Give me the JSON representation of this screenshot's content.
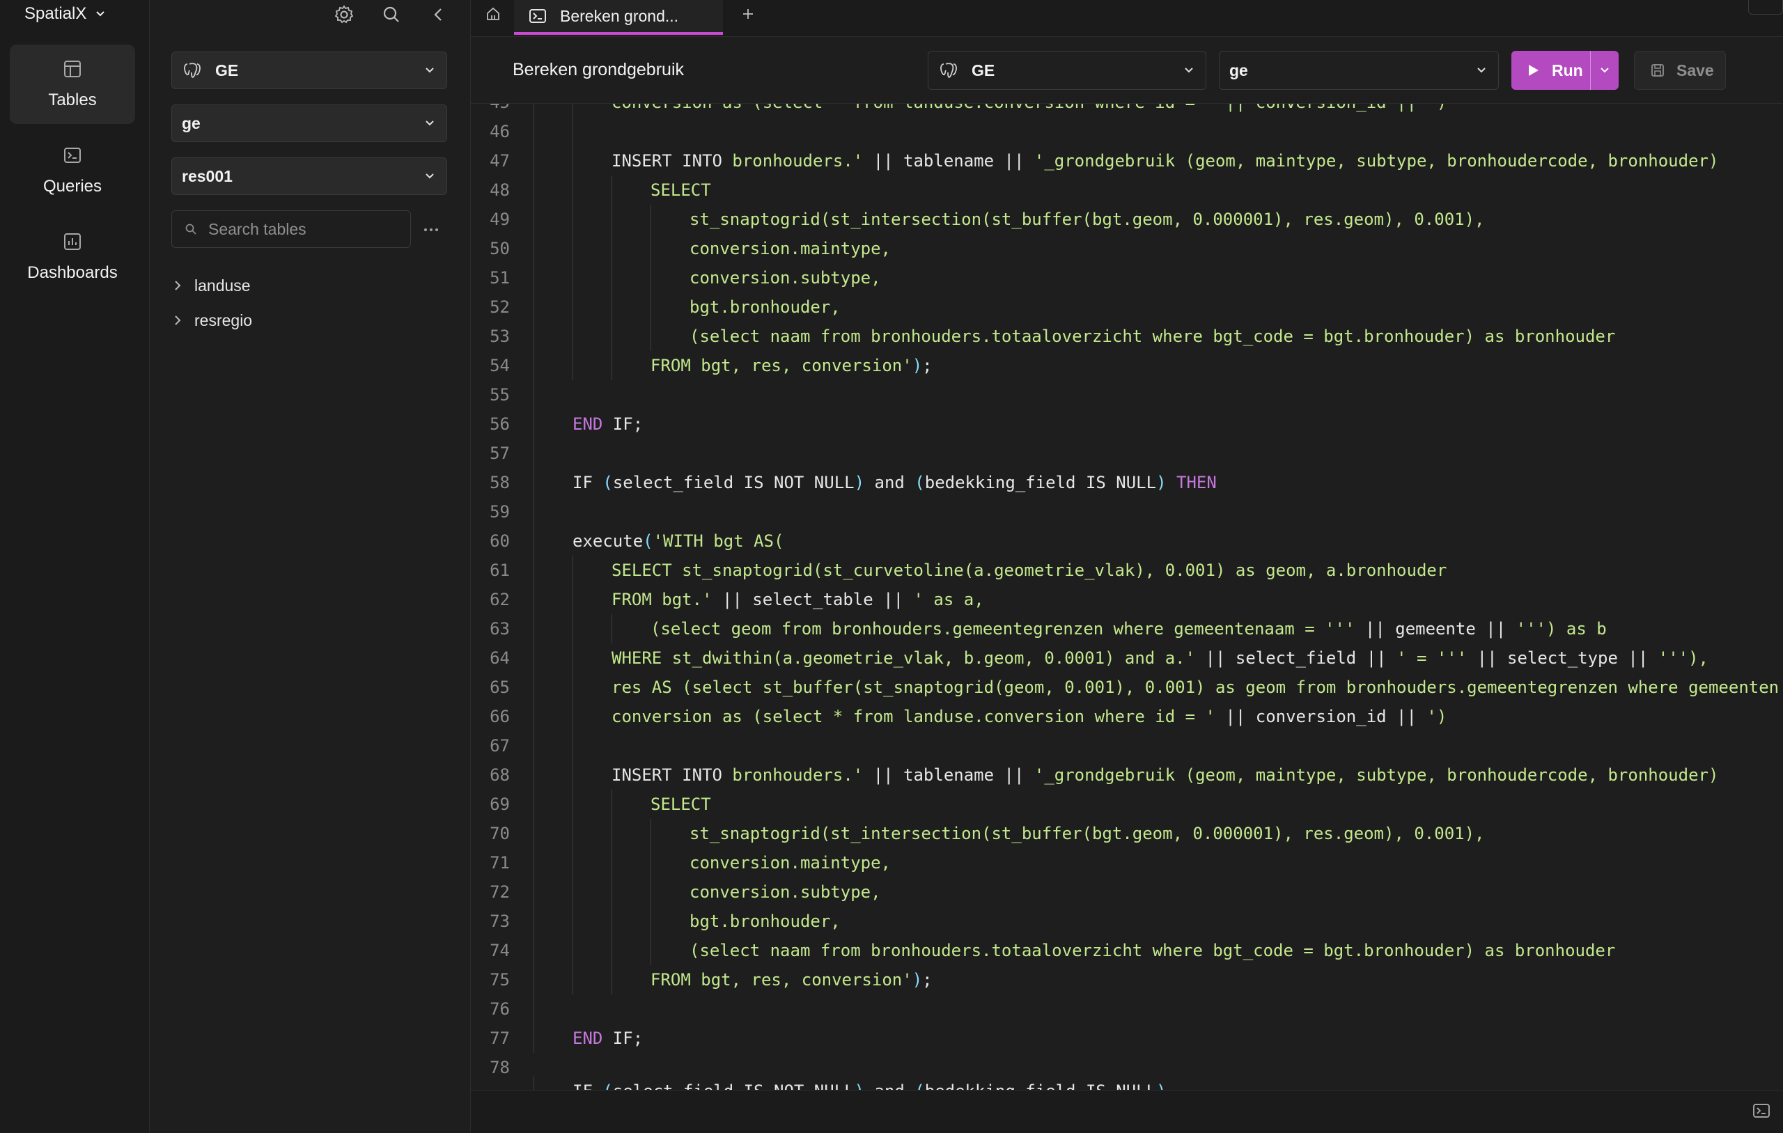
{
  "app": {
    "name": "SpatialX"
  },
  "nav": {
    "items": [
      {
        "label": "Tables",
        "icon": "table-icon",
        "active": true
      },
      {
        "label": "Queries",
        "icon": "terminal-icon",
        "active": false
      },
      {
        "label": "Dashboards",
        "icon": "chart-icon",
        "active": false
      }
    ]
  },
  "panel": {
    "connection": "GE",
    "database": "ge",
    "schema": "res001",
    "search_placeholder": "Search tables",
    "tree": [
      {
        "label": "landuse"
      },
      {
        "label": "resregio"
      }
    ]
  },
  "tabs": {
    "active": {
      "label": "Bereken grond..."
    }
  },
  "query": {
    "name": "Bereken grondgebruik",
    "connection": "GE",
    "database": "ge",
    "run_label": "Run",
    "save_label": "Save"
  },
  "colors": {
    "accent": "#b44ac0",
    "tab_underline": "#c94bd0",
    "string": "#c3e88d",
    "keyword_purple": "#c678dd",
    "paren": "#89ddff"
  },
  "editor": {
    "lines": [
      {
        "n": "46",
        "indent": 2,
        "tokens": []
      },
      {
        "n": "47",
        "indent": 2,
        "tokens": [
          [
            "kw",
            "INSERT INTO "
          ],
          [
            "str",
            "bronhouders.' "
          ],
          [
            "kw",
            "|| tablename || "
          ],
          [
            "str",
            "'_grondgebruik (geom, maintype, subtype, bronhoudercode, bronhouder)"
          ]
        ]
      },
      {
        "n": "48",
        "indent": 3,
        "tokens": [
          [
            "str",
            "SELECT"
          ]
        ]
      },
      {
        "n": "49",
        "indent": 4,
        "tokens": [
          [
            "str",
            "st_snaptogrid(st_intersection(st_buffer(bgt.geom, 0.000001), res.geom), 0.001),"
          ]
        ]
      },
      {
        "n": "50",
        "indent": 4,
        "tokens": [
          [
            "str",
            "conversion.maintype,"
          ]
        ]
      },
      {
        "n": "51",
        "indent": 4,
        "tokens": [
          [
            "str",
            "conversion.subtype,"
          ]
        ]
      },
      {
        "n": "52",
        "indent": 4,
        "tokens": [
          [
            "str",
            "bgt.bronhouder,"
          ]
        ]
      },
      {
        "n": "53",
        "indent": 4,
        "tokens": [
          [
            "str",
            "(select naam from bronhouders.totaaloverzicht where bgt_code = bgt.bronhouder) as bronhouder"
          ]
        ]
      },
      {
        "n": "54",
        "indent": 3,
        "tokens": [
          [
            "str",
            "FROM bgt, res, conversion'"
          ],
          [
            "par",
            ")"
          ],
          [
            "kw",
            ";"
          ]
        ]
      },
      {
        "n": "55",
        "indent": 1,
        "tokens": []
      },
      {
        "n": "56",
        "indent": 1,
        "tokens": [
          [
            "pk",
            "END "
          ],
          [
            "kw",
            "IF;"
          ]
        ]
      },
      {
        "n": "57",
        "indent": 1,
        "tokens": []
      },
      {
        "n": "58",
        "indent": 1,
        "tokens": [
          [
            "kw",
            "IF "
          ],
          [
            "par",
            "("
          ],
          [
            "kw",
            "select_field IS NOT NULL"
          ],
          [
            "par",
            ")"
          ],
          [
            "kw",
            " and "
          ],
          [
            "par",
            "("
          ],
          [
            "kw",
            "bedekking_field IS NULL"
          ],
          [
            "par",
            ")"
          ],
          [
            "pk",
            " THEN"
          ]
        ]
      },
      {
        "n": "59",
        "indent": 1,
        "tokens": []
      },
      {
        "n": "60",
        "indent": 1,
        "tokens": [
          [
            "kw",
            "execute"
          ],
          [
            "par",
            "("
          ],
          [
            "str",
            "'WITH bgt AS("
          ]
        ]
      },
      {
        "n": "61",
        "indent": 2,
        "tokens": [
          [
            "str",
            "SELECT st_snaptogrid(st_curvetoline(a.geometrie_vlak), 0.001) as geom, a.bronhouder"
          ]
        ]
      },
      {
        "n": "62",
        "indent": 2,
        "tokens": [
          [
            "str",
            "FROM bgt.' "
          ],
          [
            "kw",
            "|| select_table || "
          ],
          [
            "str",
            "' as a,"
          ]
        ]
      },
      {
        "n": "63",
        "indent": 3,
        "tokens": [
          [
            "str",
            "(select geom from bronhouders.gemeentegrenzen where gemeentenaam = ''' "
          ],
          [
            "kw",
            "|| gemeente || "
          ],
          [
            "str",
            "''') as b"
          ]
        ]
      },
      {
        "n": "64",
        "indent": 2,
        "tokens": [
          [
            "str",
            "WHERE st_dwithin(a.geometrie_vlak, b.geom, 0.0001) and a.' "
          ],
          [
            "kw",
            "|| select_field || "
          ],
          [
            "str",
            "' = ''' "
          ],
          [
            "kw",
            "|| select_type || "
          ],
          [
            "str",
            "'''),"
          ]
        ]
      },
      {
        "n": "65",
        "indent": 2,
        "tokens": [
          [
            "str",
            "res AS (select st_buffer(st_snaptogrid(geom, 0.001), 0.001) as geom from bronhouders.gemeentegrenzen where gemeenten"
          ]
        ]
      },
      {
        "n": "66",
        "indent": 2,
        "tokens": [
          [
            "str",
            "conversion as (select * from landuse.conversion where id = ' "
          ],
          [
            "kw",
            "|| conversion_id || "
          ],
          [
            "str",
            "')"
          ]
        ]
      },
      {
        "n": "67",
        "indent": 2,
        "tokens": []
      },
      {
        "n": "68",
        "indent": 2,
        "tokens": [
          [
            "kw",
            "INSERT INTO "
          ],
          [
            "str",
            "bronhouders.' "
          ],
          [
            "kw",
            "|| tablename || "
          ],
          [
            "str",
            "'_grondgebruik (geom, maintype, subtype, bronhoudercode, bronhouder)"
          ]
        ]
      },
      {
        "n": "69",
        "indent": 3,
        "tokens": [
          [
            "str",
            "SELECT"
          ]
        ]
      },
      {
        "n": "70",
        "indent": 4,
        "tokens": [
          [
            "str",
            "st_snaptogrid(st_intersection(st_buffer(bgt.geom, 0.000001), res.geom), 0.001),"
          ]
        ]
      },
      {
        "n": "71",
        "indent": 4,
        "tokens": [
          [
            "str",
            "conversion.maintype,"
          ]
        ]
      },
      {
        "n": "72",
        "indent": 4,
        "tokens": [
          [
            "str",
            "conversion.subtype,"
          ]
        ]
      },
      {
        "n": "73",
        "indent": 4,
        "tokens": [
          [
            "str",
            "bgt.bronhouder,"
          ]
        ]
      },
      {
        "n": "74",
        "indent": 4,
        "tokens": [
          [
            "str",
            "(select naam from bronhouders.totaaloverzicht where bgt_code = bgt.bronhouder) as bronhouder"
          ]
        ]
      },
      {
        "n": "75",
        "indent": 3,
        "tokens": [
          [
            "str",
            "FROM bgt, res, conversion'"
          ],
          [
            "par",
            ")"
          ],
          [
            "kw",
            ";"
          ]
        ]
      },
      {
        "n": "76",
        "indent": 1,
        "tokens": []
      },
      {
        "n": "77",
        "indent": 1,
        "tokens": [
          [
            "pk",
            "END "
          ],
          [
            "kw",
            "IF;"
          ]
        ]
      },
      {
        "n": "78",
        "indent": 0,
        "tokens": []
      }
    ]
  }
}
